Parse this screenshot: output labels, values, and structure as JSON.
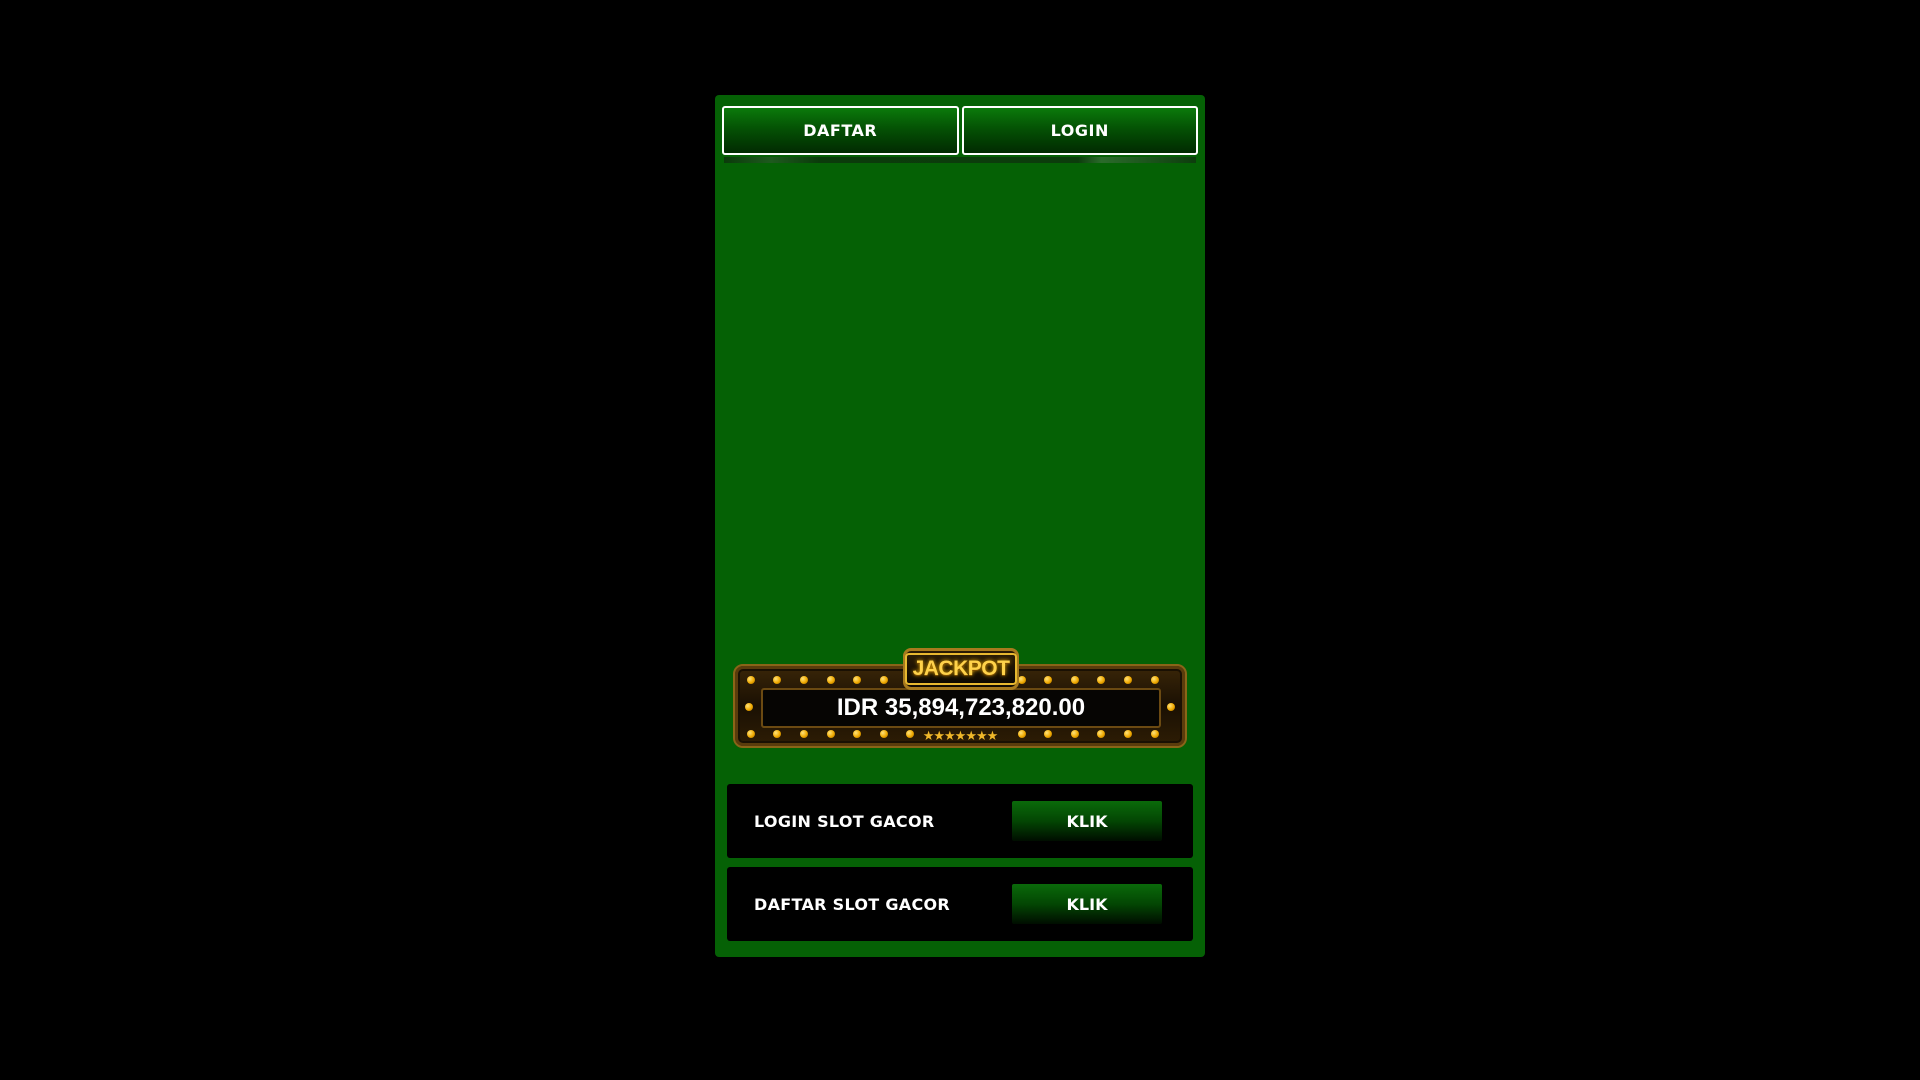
{
  "topbar": {
    "register_label": "DAFTAR",
    "login_label": "LOGIN"
  },
  "jackpot": {
    "title": "JACKPOT",
    "amount": "IDR 35,894,723,820.00",
    "stars": "★★★★★★★"
  },
  "rows": [
    {
      "label": "LOGIN SLOT GACOR",
      "button_label": "KLIK"
    },
    {
      "label": "DAFTAR SLOT GACOR",
      "button_label": "KLIK"
    }
  ],
  "colors": {
    "page_background": "#000000",
    "panel_green": "#056105",
    "button_gradient_top": "#0b7a0b",
    "button_gradient_bottom": "#012a01",
    "jackpot_gold": "#ffd24a"
  }
}
